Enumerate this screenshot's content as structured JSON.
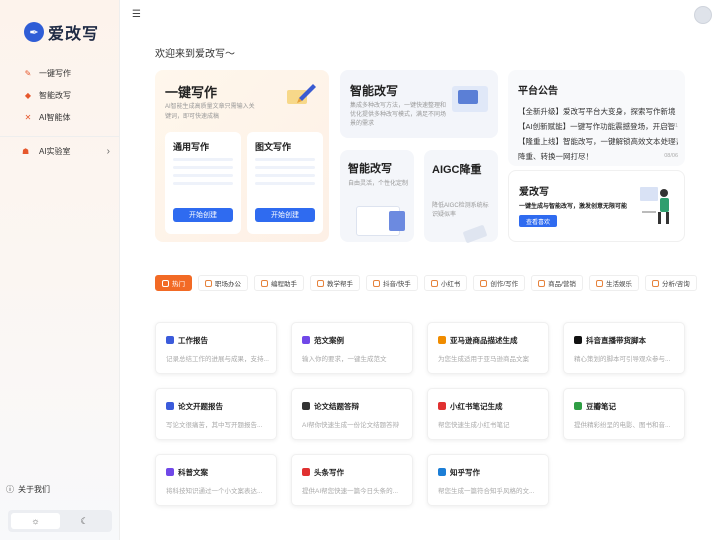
{
  "app": {
    "name": "爱改写",
    "logo_glyph": "✒"
  },
  "sidebar": {
    "items": [
      {
        "label": "一键写作",
        "icon": "pen-icon"
      },
      {
        "label": "智能改写",
        "icon": "diamond-icon"
      },
      {
        "label": "AI智能体",
        "icon": "cross-icon"
      }
    ],
    "lab": {
      "label": "AI实验室",
      "icon": "user-icon"
    },
    "about": "关于我们",
    "theme": {
      "light": "☼",
      "dark": "☾"
    }
  },
  "header": {
    "welcome": "欢迎来到爱改写～"
  },
  "hero": {
    "write": {
      "title": "一键写作",
      "sub": "AI智能生成高质量文章只需输入关键词，即可快速成稿",
      "tiles": [
        {
          "title": "通用写作",
          "button": "开始创建"
        },
        {
          "title": "图文写作",
          "button": "开始创建"
        }
      ]
    },
    "rewrite": {
      "title": "智能改写",
      "sub": "集成多种改写方法，一键快速整理和优化提供多种改写模式，满足不同场景的需求"
    },
    "rewrite_small": {
      "title": "智能改写",
      "sub": "自由灵活，个性化定制"
    },
    "aigc": {
      "title": "AIGC降重",
      "sub": "降低AIGC检测系统标识疑似率"
    },
    "notice": {
      "title": "平台公告",
      "items": [
        {
          "text": "【全新升级】爱改写平台大变身，探索写作新境",
          "date": ""
        },
        {
          "text": "【AI创新赋能】一键写作功能震撼登场，开启智",
          "date": "08/01"
        },
        {
          "text": "【隆重上线】智能改写，一键解锁高效文本处理，改写、",
          "date": "08/03"
        },
        {
          "text": "降重、转换一网打尽！",
          "date": "08/06"
        }
      ]
    },
    "promo": {
      "title": "爱改写",
      "sub": "一键生成与智能改写，激发创意无限可能",
      "button": "查看喜欢"
    }
  },
  "tabs": [
    {
      "label": "热门",
      "active": true
    },
    {
      "label": "职场办公"
    },
    {
      "label": "编程助手"
    },
    {
      "label": "教学帮手"
    },
    {
      "label": "抖音/快手"
    },
    {
      "label": "小红书"
    },
    {
      "label": "创作/写作"
    },
    {
      "label": "商品/营销"
    },
    {
      "label": "生活娱乐"
    },
    {
      "label": "分析/咨询"
    }
  ],
  "tools": [
    {
      "title": "工作报告",
      "desc": "记录总结工作的进展与成果，支持...",
      "color": "#3b5bdb"
    },
    {
      "title": "范文案例",
      "desc": "输入你的要求，一键生成范文",
      "color": "#7048e8"
    },
    {
      "title": "亚马逊商品描述生成",
      "desc": "为您生成适用于亚马逊商品文案",
      "color": "#f08c00"
    },
    {
      "title": "抖音直播带货脚本",
      "desc": "精心策划的脚本可引导观众参与...",
      "color": "#111111"
    },
    {
      "title": "论文开题报告",
      "desc": "写论文很痛苦，其中写开题报告...",
      "color": "#3b5bdb"
    },
    {
      "title": "论文结题答辩",
      "desc": "AI帮你快速生成一份论文结题答辩",
      "color": "#333333"
    },
    {
      "title": "小红书笔记生成",
      "desc": "帮您快速生成小红书笔记",
      "color": "#e03131"
    },
    {
      "title": "豆瓣笔记",
      "desc": "提供精彩纷呈的电影、图书和音...",
      "color": "#2f9e44"
    },
    {
      "title": "科普文案",
      "desc": "将科技知识通过一个小文案表达...",
      "color": "#7048e8"
    },
    {
      "title": "头条写作",
      "desc": "提供AI帮您快速一篇今日头条的...",
      "color": "#e03131"
    },
    {
      "title": "知乎写作",
      "desc": "帮您生成一篇符合知乎风格的文...",
      "color": "#1c7ed6"
    }
  ]
}
